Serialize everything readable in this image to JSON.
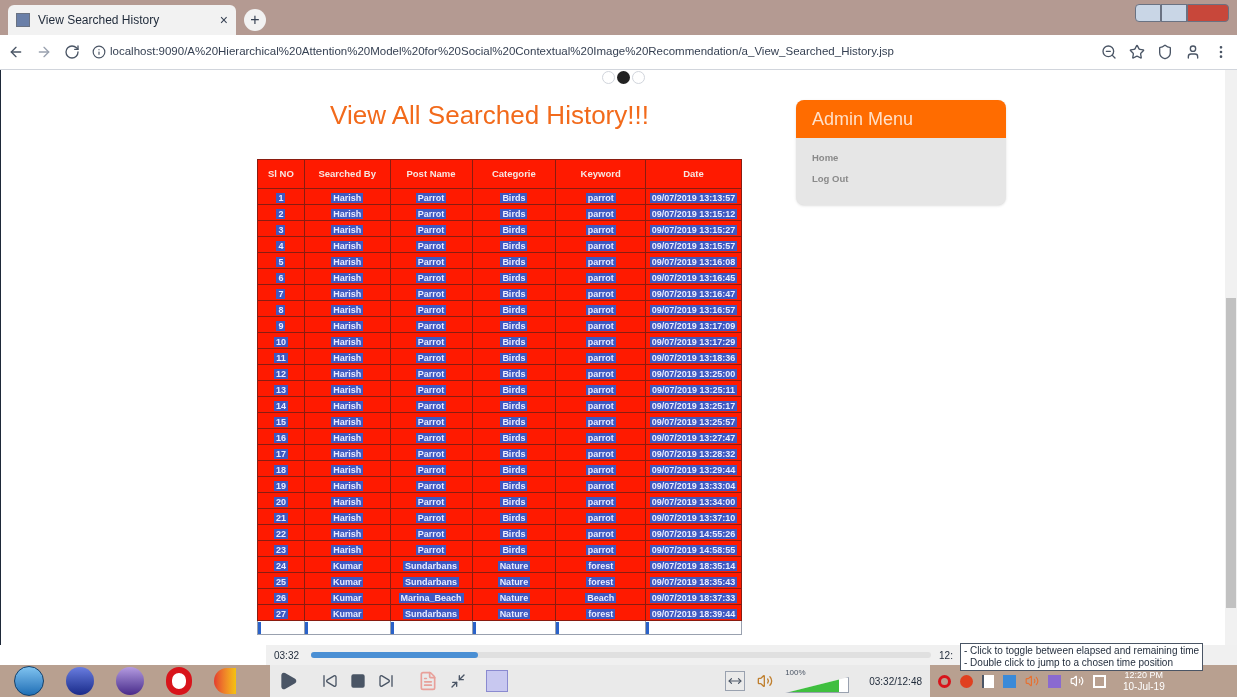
{
  "browser": {
    "tab": {
      "title": "View Searched History",
      "close": "×"
    },
    "new_tab": "+",
    "url": "localhost:9090/A%20Hierarchical%20Attention%20Model%20for%20Social%20Contextual%20Image%20Recommendation/a_View_Searched_History.jsp"
  },
  "carousel_dots": [
    {
      "selected": false
    },
    {
      "selected": true
    },
    {
      "selected": false
    }
  ],
  "page": {
    "title": "View All Searched History!!!"
  },
  "table": {
    "text_selected": true,
    "columns": [
      "Sl NO",
      "Searched By",
      "Post Name",
      "Categorie",
      "Keyword",
      "Date"
    ],
    "rows": [
      [
        "1",
        "Harish",
        "Parrot",
        "Birds",
        "parrot",
        "09/07/2019 13:13:57"
      ],
      [
        "2",
        "Harish",
        "Parrot",
        "Birds",
        "parrot",
        "09/07/2019 13:15:12"
      ],
      [
        "3",
        "Harish",
        "Parrot",
        "Birds",
        "parrot",
        "09/07/2019 13:15:27"
      ],
      [
        "4",
        "Harish",
        "Parrot",
        "Birds",
        "parrot",
        "09/07/2019 13:15:57"
      ],
      [
        "5",
        "Harish",
        "Parrot",
        "Birds",
        "parrot",
        "09/07/2019 13:16:08"
      ],
      [
        "6",
        "Harish",
        "Parrot",
        "Birds",
        "parrot",
        "09/07/2019 13:16:45"
      ],
      [
        "7",
        "Harish",
        "Parrot",
        "Birds",
        "parrot",
        "09/07/2019 13:16:47"
      ],
      [
        "8",
        "Harish",
        "Parrot",
        "Birds",
        "parrot",
        "09/07/2019 13:16:57"
      ],
      [
        "9",
        "Harish",
        "Parrot",
        "Birds",
        "parrot",
        "09/07/2019 13:17:09"
      ],
      [
        "10",
        "Harish",
        "Parrot",
        "Birds",
        "parrot",
        "09/07/2019 13:17:29"
      ],
      [
        "11",
        "Harish",
        "Parrot",
        "Birds",
        "parrot",
        "09/07/2019 13:18:36"
      ],
      [
        "12",
        "Harish",
        "Parrot",
        "Birds",
        "parrot",
        "09/07/2019 13:25:00"
      ],
      [
        "13",
        "Harish",
        "Parrot",
        "Birds",
        "parrot",
        "09/07/2019 13:25:11"
      ],
      [
        "14",
        "Harish",
        "Parrot",
        "Birds",
        "parrot",
        "09/07/2019 13:25:17"
      ],
      [
        "15",
        "Harish",
        "Parrot",
        "Birds",
        "parrot",
        "09/07/2019 13:25:57"
      ],
      [
        "16",
        "Harish",
        "Parrot",
        "Birds",
        "parrot",
        "09/07/2019 13:27:47"
      ],
      [
        "17",
        "Harish",
        "Parrot",
        "Birds",
        "parrot",
        "09/07/2019 13:28:32"
      ],
      [
        "18",
        "Harish",
        "Parrot",
        "Birds",
        "parrot",
        "09/07/2019 13:29:44"
      ],
      [
        "19",
        "Harish",
        "Parrot",
        "Birds",
        "parrot",
        "09/07/2019 13:33:04"
      ],
      [
        "20",
        "Harish",
        "Parrot",
        "Birds",
        "parrot",
        "09/07/2019 13:34:00"
      ],
      [
        "21",
        "Harish",
        "Parrot",
        "Birds",
        "parrot",
        "09/07/2019 13:37:10"
      ],
      [
        "22",
        "Harish",
        "Parrot",
        "Birds",
        "parrot",
        "09/07/2019 14:55:26"
      ],
      [
        "23",
        "Harish",
        "Parrot",
        "Birds",
        "parrot",
        "09/07/2019 14:58:55"
      ],
      [
        "24",
        "Kumar",
        "Sundarbans",
        "Nature",
        "forest",
        "09/07/2019 18:35:14"
      ],
      [
        "25",
        "Kumar",
        "Sundarbans",
        "Nature",
        "forest",
        "09/07/2019 18:35:43"
      ],
      [
        "26",
        "Kumar",
        "Marina_Beach",
        "Nature",
        "Beach",
        "09/07/2019 18:37:33"
      ],
      [
        "27",
        "Kumar",
        "Sundarbans",
        "Nature",
        "forest",
        "09/07/2019 18:39:44"
      ]
    ]
  },
  "admin_menu": {
    "title": "Admin Menu",
    "items": [
      "Home",
      "Log Out"
    ]
  },
  "player": {
    "elapsed": "03:32",
    "level": 0.27,
    "total": "12:",
    "time": "03:32/12:48",
    "volume": {
      "reading": "100%",
      "level": 0.85
    }
  },
  "tooltip": {
    "lines": [
      "- Click to toggle between elapsed and remaining time",
      "- Double click to jump to a chosen time position"
    ]
  },
  "taskbar": {
    "time": "12:20 PM",
    "date": "10-Jul-19"
  }
}
